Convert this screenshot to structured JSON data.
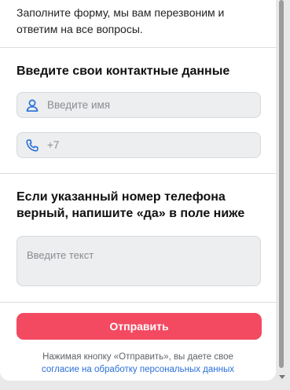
{
  "intro_text": "Заполните форму, мы вам перезвоним и ответим на все вопросы.",
  "contact_section": {
    "heading": "Введите свои контактные данные",
    "name_field": {
      "placeholder": "Введите имя",
      "icon": "person-icon"
    },
    "phone_field": {
      "value": "+7",
      "icon": "phone-icon"
    }
  },
  "confirm_section": {
    "heading": "Если указанный номер телефона верный, напишите «да» в поле ниже",
    "textarea_placeholder": "Введите текст"
  },
  "submit_label": "Отправить",
  "consent": {
    "text": "Нажимая кнопку «Отправить», вы даете свое",
    "link_text": "согласие на обработку персональных данных"
  },
  "colors": {
    "accent": "#f34a62",
    "icon_blue": "#2a6fd8",
    "link": "#2a6fd8"
  }
}
